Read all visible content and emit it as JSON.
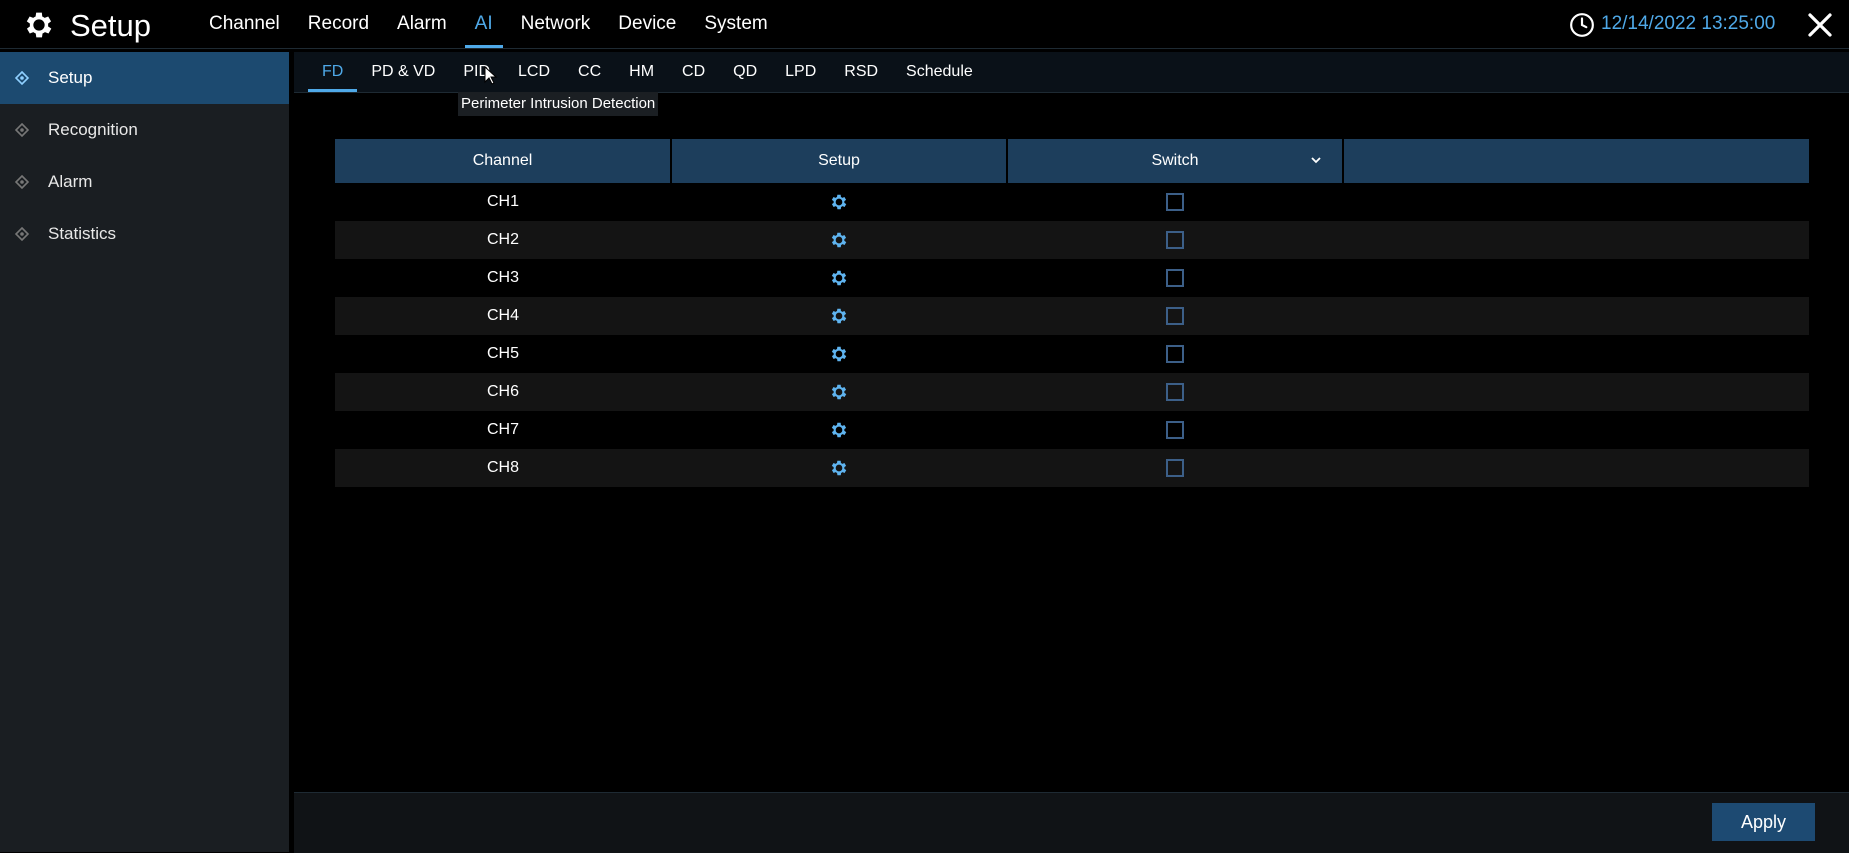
{
  "header": {
    "title": "Setup",
    "app_icon": "gear-icon",
    "nav": [
      {
        "label": "Channel"
      },
      {
        "label": "Record"
      },
      {
        "label": "Alarm"
      },
      {
        "label": "AI",
        "active": true
      },
      {
        "label": "Network"
      },
      {
        "label": "Device"
      },
      {
        "label": "System"
      }
    ],
    "clock_icon": "clock-icon",
    "datetime": "12/14/2022 13:25:00",
    "close_icon": "close-icon"
  },
  "sidebar": {
    "items": [
      {
        "label": "Setup",
        "active": true
      },
      {
        "label": "Recognition"
      },
      {
        "label": "Alarm"
      },
      {
        "label": "Statistics"
      }
    ]
  },
  "subtabs": [
    {
      "label": "FD",
      "active": true
    },
    {
      "label": "PD & VD"
    },
    {
      "label": "PID"
    },
    {
      "label": "LCD"
    },
    {
      "label": "CC"
    },
    {
      "label": "HM"
    },
    {
      "label": "CD"
    },
    {
      "label": "QD"
    },
    {
      "label": "LPD"
    },
    {
      "label": "RSD"
    },
    {
      "label": "Schedule"
    }
  ],
  "tooltip": "Perimeter Intrusion Detection",
  "table": {
    "columns": {
      "channel": "Channel",
      "setup": "Setup",
      "switch": "Switch",
      "extra": ""
    },
    "rows": [
      {
        "channel": "CH1",
        "switch": false
      },
      {
        "channel": "CH2",
        "switch": false
      },
      {
        "channel": "CH3",
        "switch": false
      },
      {
        "channel": "CH4",
        "switch": false
      },
      {
        "channel": "CH5",
        "switch": false
      },
      {
        "channel": "CH6",
        "switch": false
      },
      {
        "channel": "CH7",
        "switch": false
      },
      {
        "channel": "CH8",
        "switch": false
      }
    ]
  },
  "footer": {
    "apply_label": "Apply"
  },
  "colors": {
    "accent": "#4fa9e8",
    "header_row": "#1d3e5c",
    "active_side": "#1c4a70",
    "button": "#1d4a72"
  }
}
